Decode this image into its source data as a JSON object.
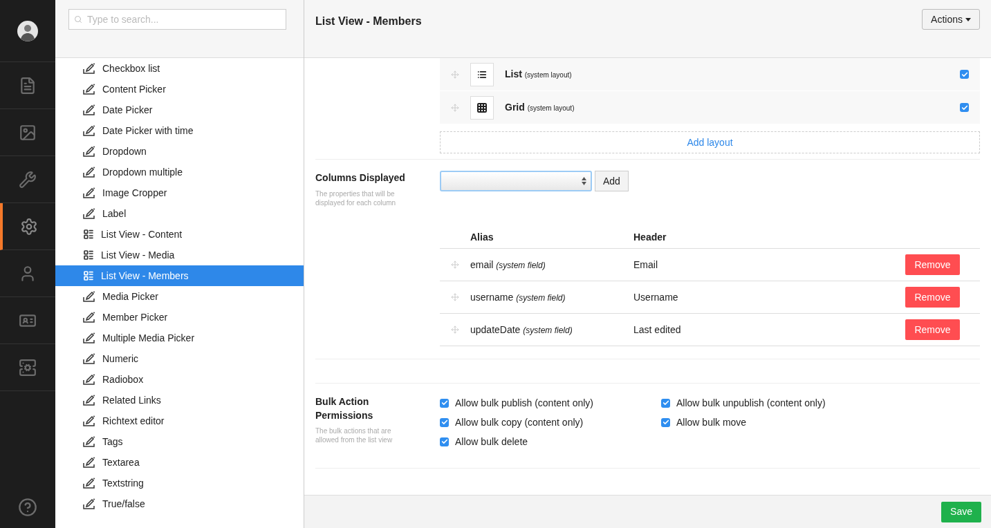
{
  "nav": {
    "items": [
      {
        "kind": "document",
        "selected": false
      },
      {
        "kind": "image",
        "selected": false
      },
      {
        "kind": "wrench",
        "selected": false
      },
      {
        "kind": "gear",
        "selected": true
      },
      {
        "kind": "user",
        "selected": false
      },
      {
        "kind": "idcard",
        "selected": false
      },
      {
        "kind": "stack",
        "selected": false
      }
    ]
  },
  "search": {
    "placeholder": "Type to search..."
  },
  "tree": {
    "items": [
      {
        "label": "Checkbox list",
        "kind": "editor",
        "selected": false
      },
      {
        "label": "Content Picker",
        "kind": "editor",
        "selected": false
      },
      {
        "label": "Date Picker",
        "kind": "editor",
        "selected": false
      },
      {
        "label": "Date Picker with time",
        "kind": "editor",
        "selected": false
      },
      {
        "label": "Dropdown",
        "kind": "editor",
        "selected": false
      },
      {
        "label": "Dropdown multiple",
        "kind": "editor",
        "selected": false
      },
      {
        "label": "Image Cropper",
        "kind": "editor",
        "selected": false
      },
      {
        "label": "Label",
        "kind": "editor",
        "selected": false
      },
      {
        "label": "List View - Content",
        "kind": "listview",
        "selected": false
      },
      {
        "label": "List View - Media",
        "kind": "listview",
        "selected": false
      },
      {
        "label": "List View - Members",
        "kind": "listview",
        "selected": true
      },
      {
        "label": "Media Picker",
        "kind": "editor",
        "selected": false
      },
      {
        "label": "Member Picker",
        "kind": "editor",
        "selected": false
      },
      {
        "label": "Multiple Media Picker",
        "kind": "editor",
        "selected": false
      },
      {
        "label": "Numeric",
        "kind": "editor",
        "selected": false
      },
      {
        "label": "Radiobox",
        "kind": "editor",
        "selected": false
      },
      {
        "label": "Related Links",
        "kind": "editor",
        "selected": false
      },
      {
        "label": "Richtext editor",
        "kind": "editor",
        "selected": false
      },
      {
        "label": "Tags",
        "kind": "editor",
        "selected": false
      },
      {
        "label": "Textarea",
        "kind": "editor",
        "selected": false
      },
      {
        "label": "Textstring",
        "kind": "editor",
        "selected": false
      },
      {
        "label": "True/false",
        "kind": "editor",
        "selected": false
      }
    ]
  },
  "header": {
    "title": "List View - Members",
    "actions": "Actions"
  },
  "layouts": {
    "items": [
      {
        "name": "List",
        "note": "(system layout)",
        "kind": "list",
        "checked": true
      },
      {
        "name": "Grid",
        "note": "(system layout)",
        "kind": "grid",
        "checked": true
      }
    ],
    "add": "Add layout"
  },
  "columns_displayed": {
    "label": "Columns Displayed",
    "description": "The properties that will be displayed for each column",
    "add_button": "Add",
    "table": {
      "columns": [
        "Alias",
        "Header"
      ],
      "rows": [
        {
          "alias": "email",
          "note": "(system field)",
          "header": "Email",
          "action": "Remove"
        },
        {
          "alias": "username",
          "note": "(system field)",
          "header": "Username",
          "action": "Remove"
        },
        {
          "alias": "updateDate",
          "note": "(system field)",
          "header": "Last edited",
          "action": "Remove"
        }
      ]
    }
  },
  "bulk": {
    "label": "Bulk Action Permissions",
    "description": "The bulk actions that are allowed from the list view",
    "options": [
      {
        "label": "Allow bulk publish (content only)",
        "checked": true
      },
      {
        "label": "Allow bulk unpublish (content only)",
        "checked": true
      },
      {
        "label": "Allow bulk copy (content only)",
        "checked": true
      },
      {
        "label": "Allow bulk move",
        "checked": true
      },
      {
        "label": "Allow bulk delete",
        "checked": true
      }
    ]
  },
  "footer": {
    "save": "Save"
  }
}
